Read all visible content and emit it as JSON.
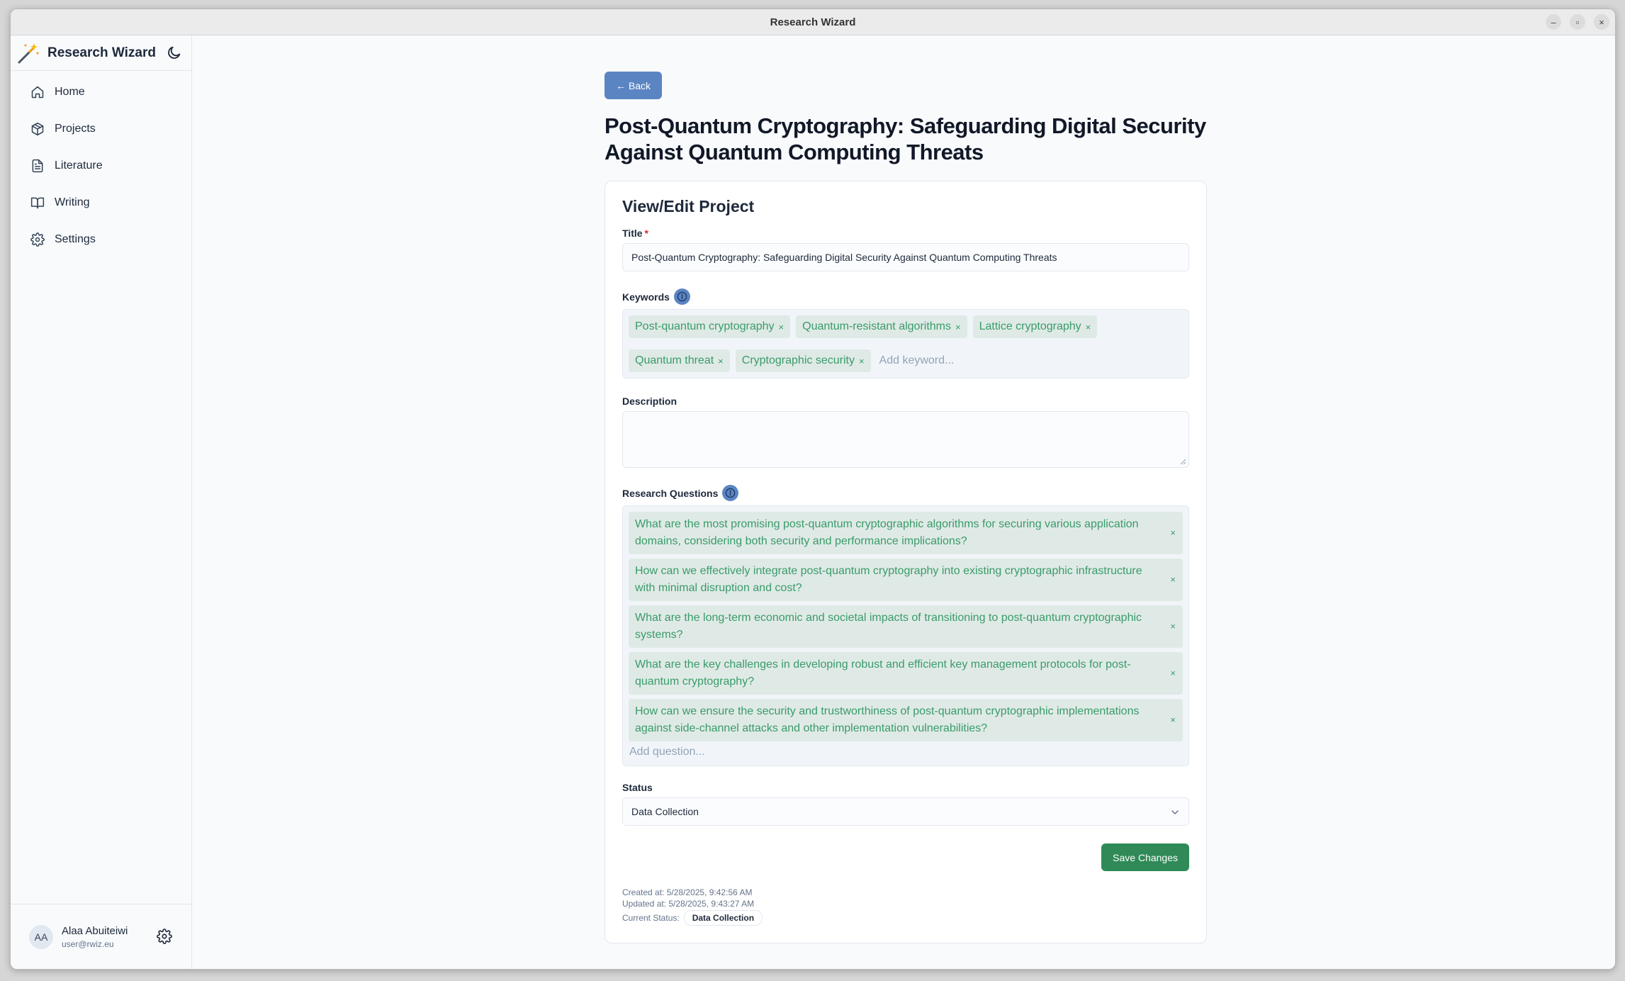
{
  "window": {
    "title": "Research Wizard"
  },
  "sidebar": {
    "brand": "Research Wizard",
    "items": [
      {
        "label": "Home",
        "icon": "home-icon"
      },
      {
        "label": "Projects",
        "icon": "box-icon"
      },
      {
        "label": "Literature",
        "icon": "document-icon"
      },
      {
        "label": "Writing",
        "icon": "book-open-icon"
      },
      {
        "label": "Settings",
        "icon": "gear-icon"
      }
    ],
    "user": {
      "initials": "AA",
      "name": "Alaa Abuiteiwi",
      "email": "user@rwiz.eu"
    }
  },
  "page": {
    "back_label": "← Back",
    "title": "Post-Quantum Cryptography: Safeguarding Digital Security Against Quantum Computing Threats"
  },
  "form": {
    "heading": "View/Edit Project",
    "title_label": "Title",
    "required_mark": "*",
    "title_value": "Post-Quantum Cryptography: Safeguarding Digital Security Against Quantum Computing Threats",
    "keywords_label": "Keywords",
    "keywords": [
      "Post-quantum cryptography",
      "Quantum-resistant algorithms",
      "Lattice cryptography",
      "Quantum threat",
      "Cryptographic security"
    ],
    "remove_symbol": "×",
    "keyword_placeholder": "Add keyword...",
    "description_label": "Description",
    "description_value": "",
    "questions_label": "Research Questions",
    "questions": [
      "What are the most promising post-quantum cryptographic algorithms for securing various application domains, considering both security and performance implications?",
      "How can we effectively integrate post-quantum cryptography into existing cryptographic infrastructure with minimal disruption and cost?",
      "What are the long-term economic and societal impacts of transitioning to post-quantum cryptographic systems?",
      "What are the key challenges in developing robust and efficient key management protocols for post-quantum cryptography?",
      "How can we ensure the security and trustworthiness of post-quantum cryptographic implementations against side-channel attacks and other implementation vulnerabilities?"
    ],
    "question_placeholder": "Add question...",
    "status_label": "Status",
    "status_value": "Data Collection",
    "save_label": "Save Changes",
    "created_at": "Created at: 5/28/2025, 9:42:56 AM",
    "updated_at": "Updated at: 5/28/2025, 9:43:27 AM",
    "current_status_label": "Current Status:",
    "current_status_value": "Data Collection"
  },
  "colors": {
    "accent_blue": "#5b85c2",
    "save_green": "#2f8a57",
    "chip_bg": "#dfeae6",
    "chip_text": "#3a9b6a"
  }
}
